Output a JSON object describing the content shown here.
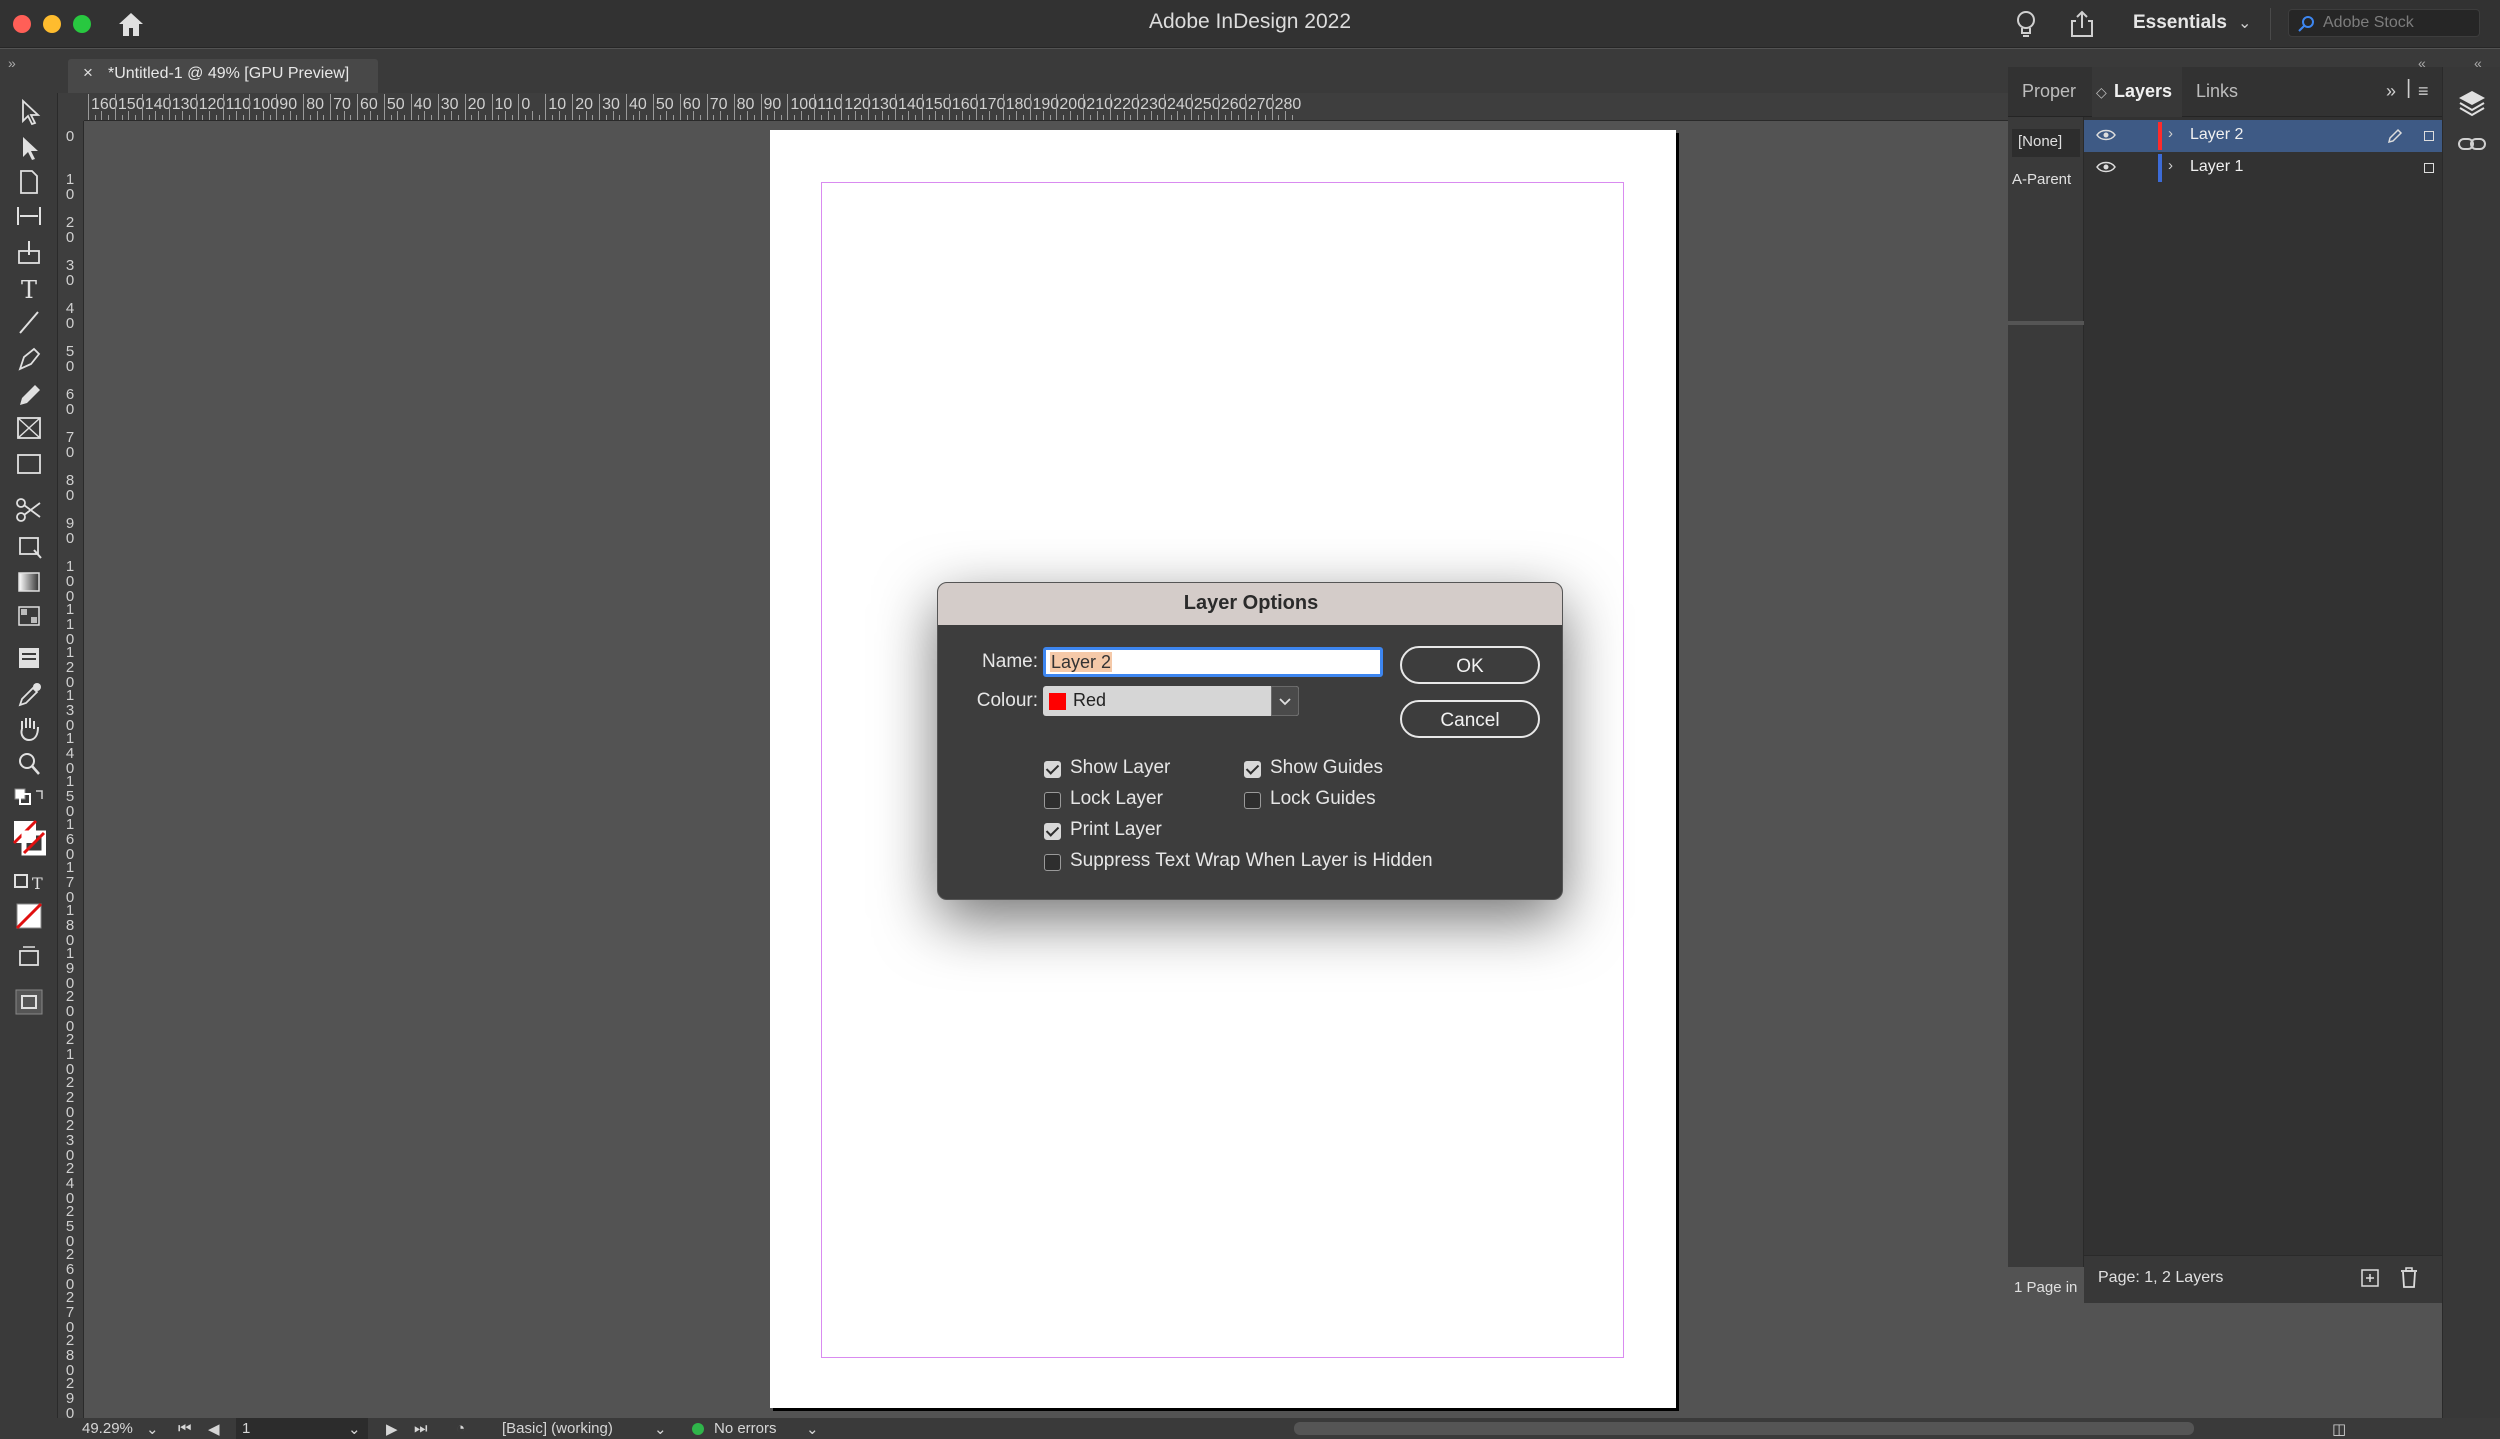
{
  "app": {
    "title": "Adobe InDesign 2022",
    "workspace": "Essentials",
    "stock_placeholder": "Adobe Stock"
  },
  "document": {
    "tab_title": "*Untitled-1 @ 49% [GPU Preview]"
  },
  "ruler": {
    "horizontal": [
      "160",
      "150",
      "140",
      "130",
      "120",
      "110",
      "100",
      "90",
      "80",
      "70",
      "60",
      "50",
      "40",
      "30",
      "20",
      "10",
      "0",
      "10",
      "20",
      "30",
      "40",
      "50",
      "60",
      "70",
      "80",
      "90",
      "100",
      "110",
      "120",
      "130",
      "140",
      "150",
      "160",
      "170",
      "180",
      "190",
      "200",
      "210",
      "220",
      "230",
      "240",
      "250",
      "260",
      "270",
      "280"
    ],
    "vertical": [
      "0",
      "10",
      "20",
      "30",
      "40",
      "50",
      "60",
      "70",
      "80",
      "90",
      "100",
      "110",
      "120",
      "130",
      "140",
      "150",
      "160",
      "170",
      "180",
      "190",
      "200",
      "210",
      "220",
      "230",
      "240",
      "250",
      "260",
      "270",
      "280",
      "290"
    ]
  },
  "panel": {
    "tabs": [
      "Proper",
      "Layers",
      "Links"
    ],
    "pages_none": "[None]",
    "pages_parent": "A-Parent",
    "pages_count": "1 Page in",
    "layers": [
      {
        "name": "Layer 2",
        "color": "#ff2b2b",
        "selected": true
      },
      {
        "name": "Layer 1",
        "color": "#3c6bd6",
        "selected": false
      }
    ],
    "footer": "Page: 1, 2 Layers"
  },
  "status": {
    "zoom": "49.29%",
    "page": "1",
    "preflight_profile": "[Basic] (working)",
    "errors": "No errors"
  },
  "dialog": {
    "title": "Layer Options",
    "name_label": "Name:",
    "name_value": "Layer 2",
    "colour_label": "Colour:",
    "colour_value": "Red",
    "colour_swatch": "#ff0000",
    "ok_label": "OK",
    "cancel_label": "Cancel",
    "checkboxes": {
      "show_layer": {
        "label": "Show Layer",
        "checked": true
      },
      "show_guides": {
        "label": "Show Guides",
        "checked": true
      },
      "lock_layer": {
        "label": "Lock Layer",
        "checked": false
      },
      "lock_guides": {
        "label": "Lock Guides",
        "checked": false
      },
      "print_layer": {
        "label": "Print Layer",
        "checked": true
      },
      "suppress_wrap": {
        "label": "Suppress Text Wrap When Layer is Hidden",
        "checked": false
      }
    }
  }
}
